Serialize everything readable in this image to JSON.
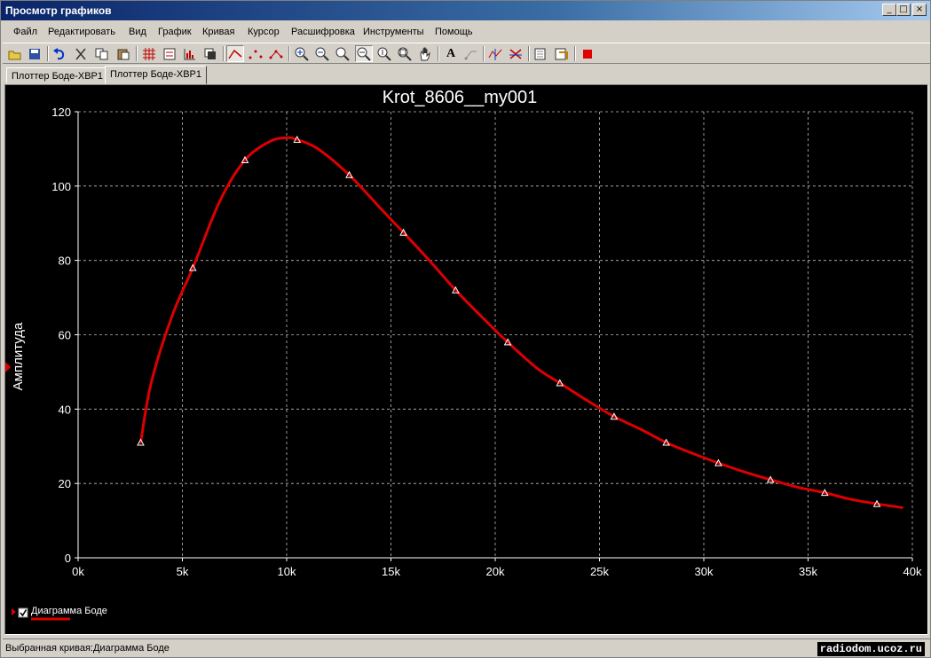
{
  "window": {
    "title": "Просмотр графиков",
    "controls": [
      "_",
      "□",
      "×"
    ]
  },
  "menu": [
    "Файл",
    "Редактировать",
    "Вид",
    "График",
    "Кривая",
    "Курсор",
    "Расшифровка",
    "Инструменты",
    "Помощь"
  ],
  "toolbar_icons": [
    "open-icon",
    "save-icon",
    "undo-icon",
    "cut-icon",
    "copy-icon",
    "paste-icon",
    "grid-icon",
    "legend-icon",
    "chart-properties-icon",
    "overlay-icon",
    "line-icon",
    "points-icon",
    "line-points-icon",
    "zoom-in-icon",
    "zoom-out-icon",
    "zoom-fit-icon",
    "zoom-x-icon",
    "zoom-y-icon",
    "zoom-full-icon",
    "pan-icon",
    "text-icon",
    "label-icon",
    "cursor-icon",
    "cursor-toggle-icon",
    "export-icon",
    "export-image-icon",
    "stop-icon"
  ],
  "tabs": [
    {
      "label": "Плоттер Боде-XBP1",
      "active": false
    },
    {
      "label": "Плоттер Боде-XBP1",
      "active": true
    }
  ],
  "status": {
    "text": "Выбранная кривая:Диаграмма Боде",
    "watermark": "radiodom.ucoz.ru"
  },
  "legend": {
    "label": "Диаграмма Боде",
    "checked": true
  },
  "chart_data": {
    "type": "line",
    "title": "Krot_8606__my001",
    "xlabel": "",
    "ylabel": "Амплитуда",
    "xlim": [
      0,
      40000
    ],
    "ylim": [
      0,
      120
    ],
    "xticks": [
      "0k",
      "5k",
      "10k",
      "15k",
      "20k",
      "25k",
      "30k",
      "35k",
      "40k"
    ],
    "yticks": [
      "0",
      "20",
      "40",
      "60",
      "80",
      "100",
      "120"
    ],
    "grid": true,
    "legend_position": "bottom-left",
    "background": "#000000",
    "series": [
      {
        "name": "Диаграмма Боде",
        "color": "#dd0000",
        "x": [
          3000,
          3500,
          4500,
          5500,
          6800,
          8000,
          9200,
          10000,
          10500,
          11500,
          13000,
          14500,
          15600,
          17000,
          18100,
          19500,
          20600,
          22000,
          23100,
          24500,
          25700,
          27000,
          28200,
          29500,
          30700,
          32000,
          33200,
          34500,
          35800,
          37000,
          38300,
          39500
        ],
        "y": [
          31,
          47,
          65,
          78,
          96,
          107,
          112,
          113,
          112.5,
          110,
          103,
          94,
          87.5,
          79,
          72,
          64,
          58,
          51,
          47,
          42,
          38,
          34.5,
          31,
          28,
          25.5,
          23,
          21,
          19,
          17.5,
          15.8,
          14.5,
          13.5
        ]
      }
    ],
    "markers": {
      "x": [
        3000,
        5500,
        8000,
        10500,
        13000,
        15600,
        18100,
        20600,
        23100,
        25700,
        28200,
        30700,
        33200,
        35800,
        38300
      ],
      "y": [
        31,
        78,
        107,
        112.5,
        103,
        87.5,
        72,
        58,
        47,
        38,
        31,
        25.5,
        21,
        17.5,
        14.5
      ]
    }
  }
}
